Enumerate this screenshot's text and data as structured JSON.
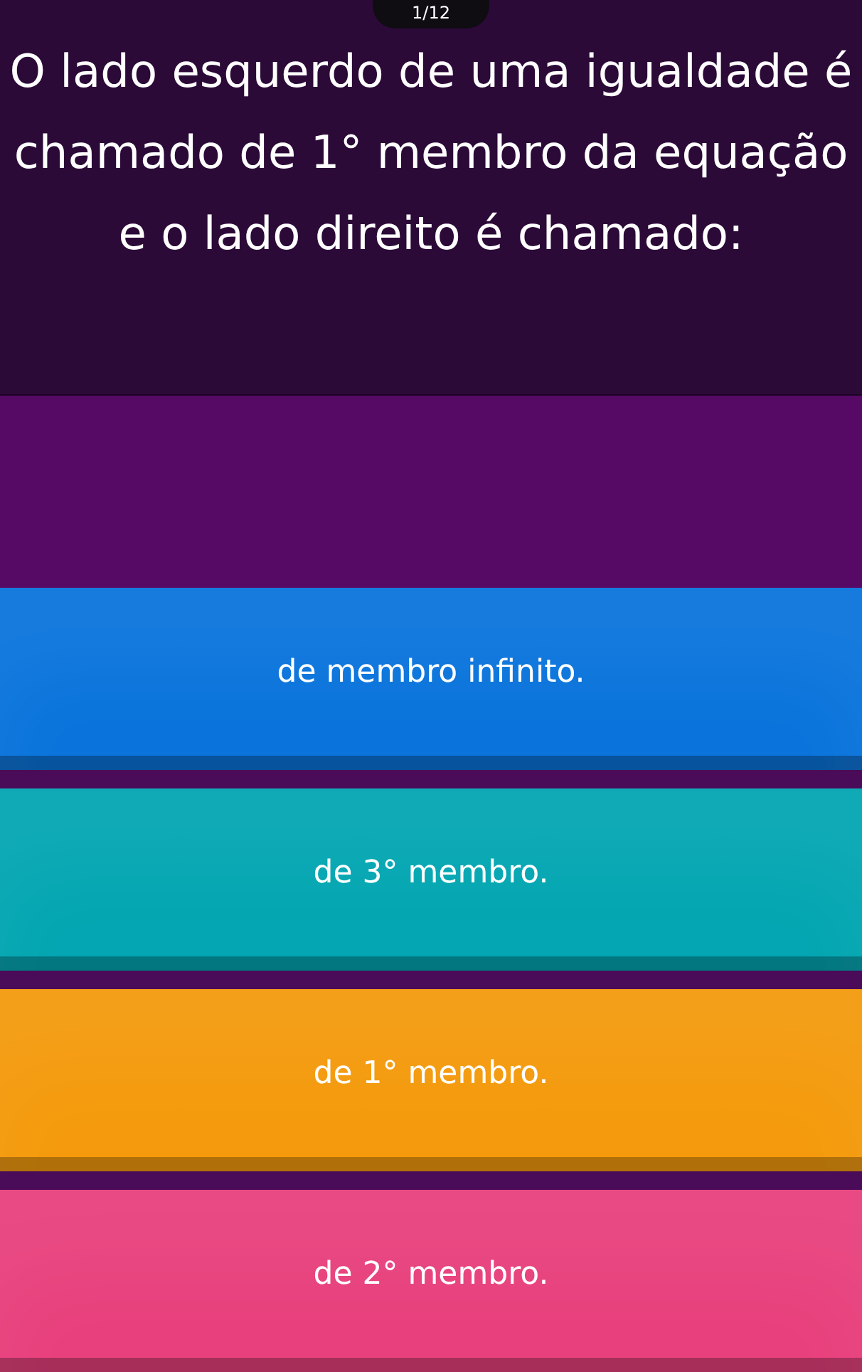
{
  "counter": "1/12",
  "question": "O lado esquerdo de uma igualdade é chamado de 1° membro da equação e o lado direito é chamado:",
  "answers": [
    {
      "text": "de membro infinito.",
      "color": "#0a74dc"
    },
    {
      "text": "de 3° membro.",
      "color": "#03a6b2"
    },
    {
      "text": "de 1° membro.",
      "color": "#f49a0c"
    },
    {
      "text": "de 2° membro.",
      "color": "#e8407c"
    }
  ]
}
